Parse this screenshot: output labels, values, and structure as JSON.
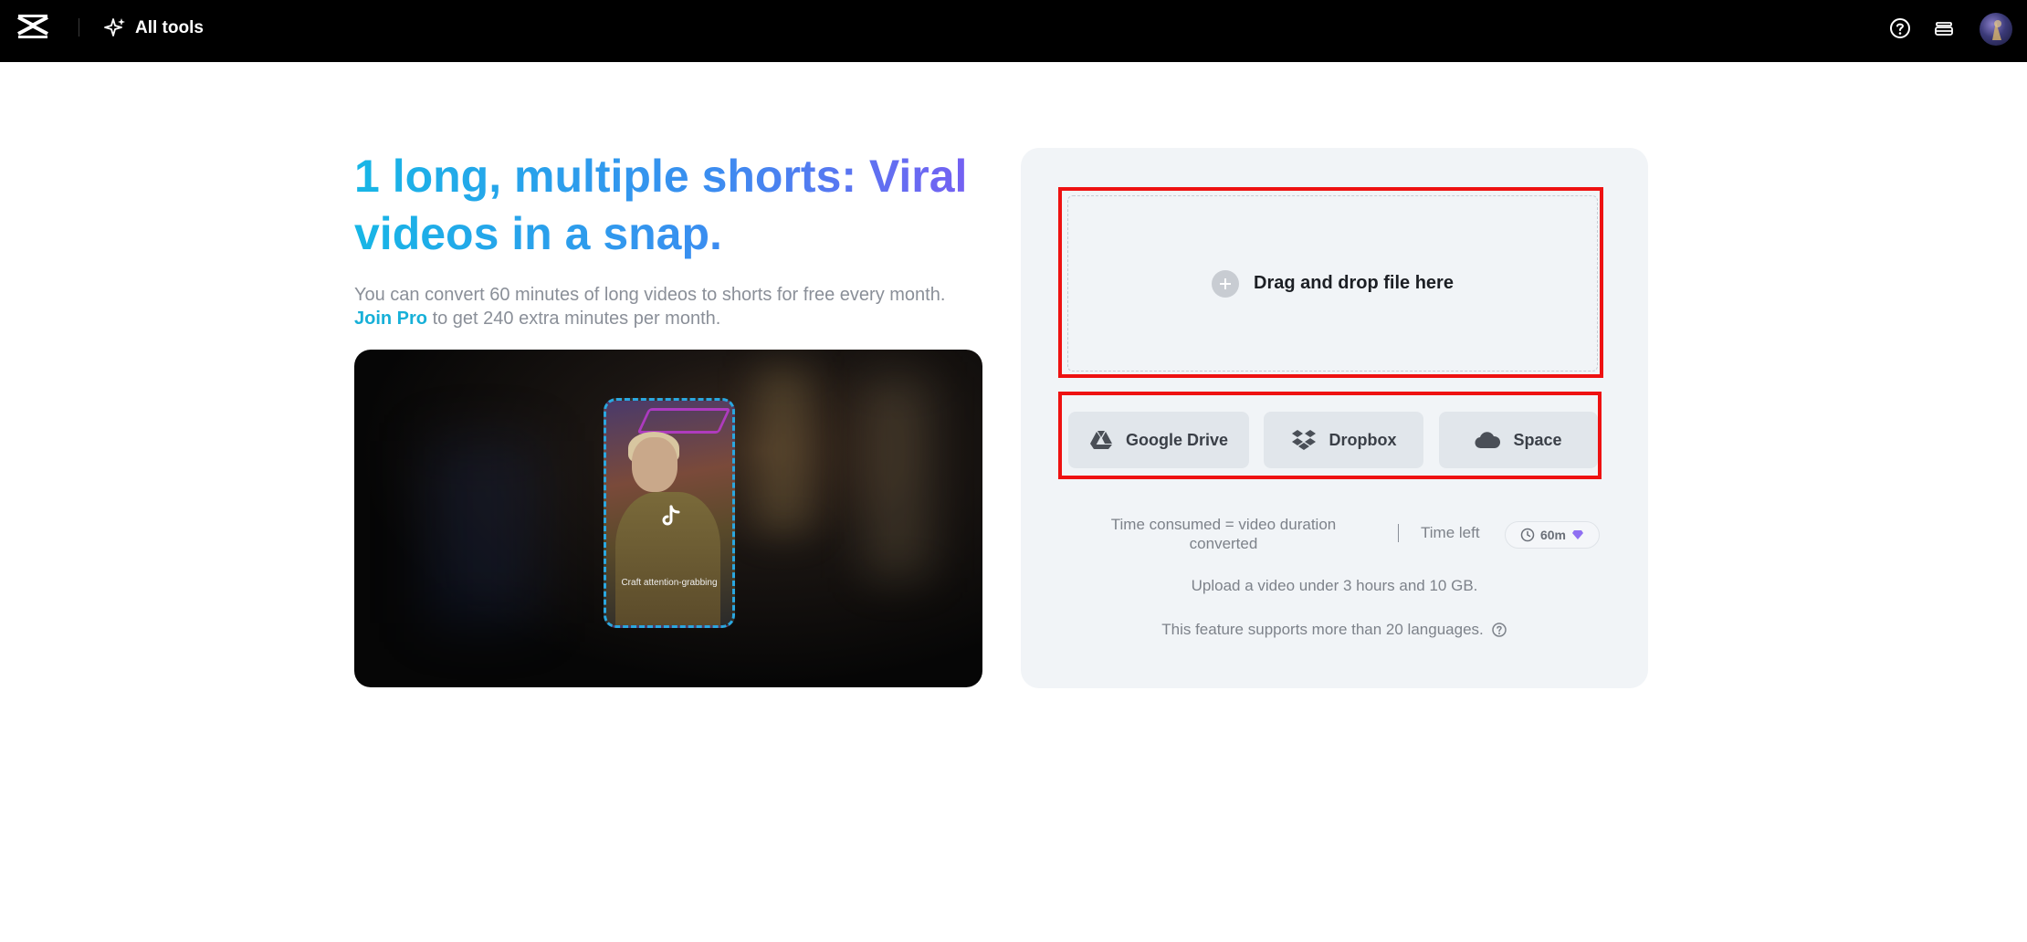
{
  "topbar": {
    "all_tools_label": "All tools"
  },
  "hero": {
    "headline": "1 long, multiple shorts: Viral videos in a snap.",
    "desc_part1": "You can convert 60 minutes of long videos to shorts for free every month. ",
    "join_pro": "Join Pro",
    "desc_part2": " to get 240 extra minutes per month.",
    "preview_caption": "Craft attention-grabbing"
  },
  "upload": {
    "drop_label": "Drag and drop file here",
    "sources": [
      {
        "label": "Google Drive",
        "icon": "google-drive-icon"
      },
      {
        "label": "Dropbox",
        "icon": "dropbox-icon"
      },
      {
        "label": "Space",
        "icon": "cloud-icon"
      }
    ],
    "time_consumed_line1": "Time consumed = video duration",
    "time_consumed_line2": "converted",
    "time_left_label": "Time left",
    "time_left_value": "60m",
    "limit_note": "Upload a video under 3 hours and 10 GB.",
    "languages_note": "This feature supports more than 20 languages."
  },
  "colors": {
    "topbar_bg": "#000000",
    "accent_cyan": "#17b6e6",
    "accent_purple": "#7a5cf2",
    "panel_bg": "#f1f4f7",
    "highlight": "#ee1111"
  }
}
